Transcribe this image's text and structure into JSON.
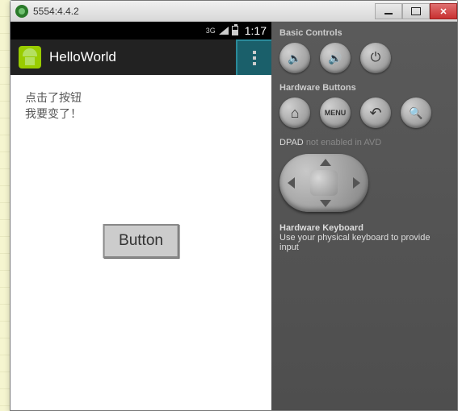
{
  "window": {
    "title": "5554:4.4.2"
  },
  "statusbar": {
    "net": "3G",
    "time": "1:17"
  },
  "appbar": {
    "title": "HelloWorld"
  },
  "content": {
    "line1": "点击了按钮",
    "line2": "我要变了！",
    "button_label": "Button"
  },
  "panel": {
    "basic_label": "Basic Controls",
    "hw_label": "Hardware Buttons",
    "menu_text": "MENU",
    "dpad_label": "DPAD",
    "dpad_status": "not enabled in AVD",
    "hk_title": "Hardware Keyboard",
    "hk_text": "Use your physical keyboard to provide input"
  }
}
